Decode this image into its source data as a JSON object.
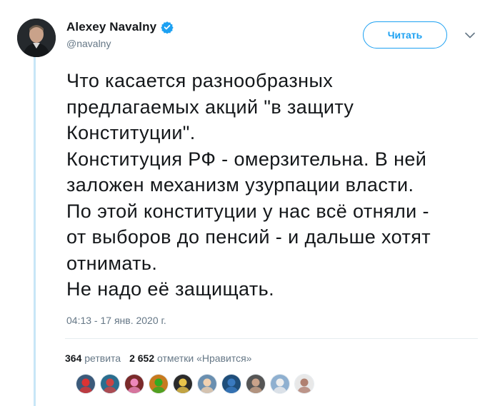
{
  "tweet": {
    "author": {
      "display_name": "Alexey Navalny",
      "handle": "@navalny",
      "verified": true
    },
    "follow_button_label": "Читать",
    "menu_icon": "chevron-down-icon",
    "text_lines": [
      "Что касается разнообразных",
      "предлагаемых акций \"в защиту",
      "Конституции\".",
      "Конституция РФ - омерзительна. В ней",
      "заложен механизм узурпации власти.",
      "По этой конституции у нас всё отняли -",
      "от выборов до пенсий - и дальше хотят",
      "отнимать.",
      "Не надо её защищать."
    ],
    "timestamp": "04:13 - 17 янв. 2020 г.",
    "stats": {
      "retweets_count": "364",
      "retweets_label": "ретвита",
      "likes_count": "2 652",
      "likes_label": "отметки «Нравится»"
    },
    "liked_by_avatars_count": 10
  },
  "colors": {
    "accent": "#1da1f2",
    "text": "#14171a",
    "muted": "#657786",
    "thread_line": "#c8e6f7",
    "divider": "#e6ecf0"
  }
}
